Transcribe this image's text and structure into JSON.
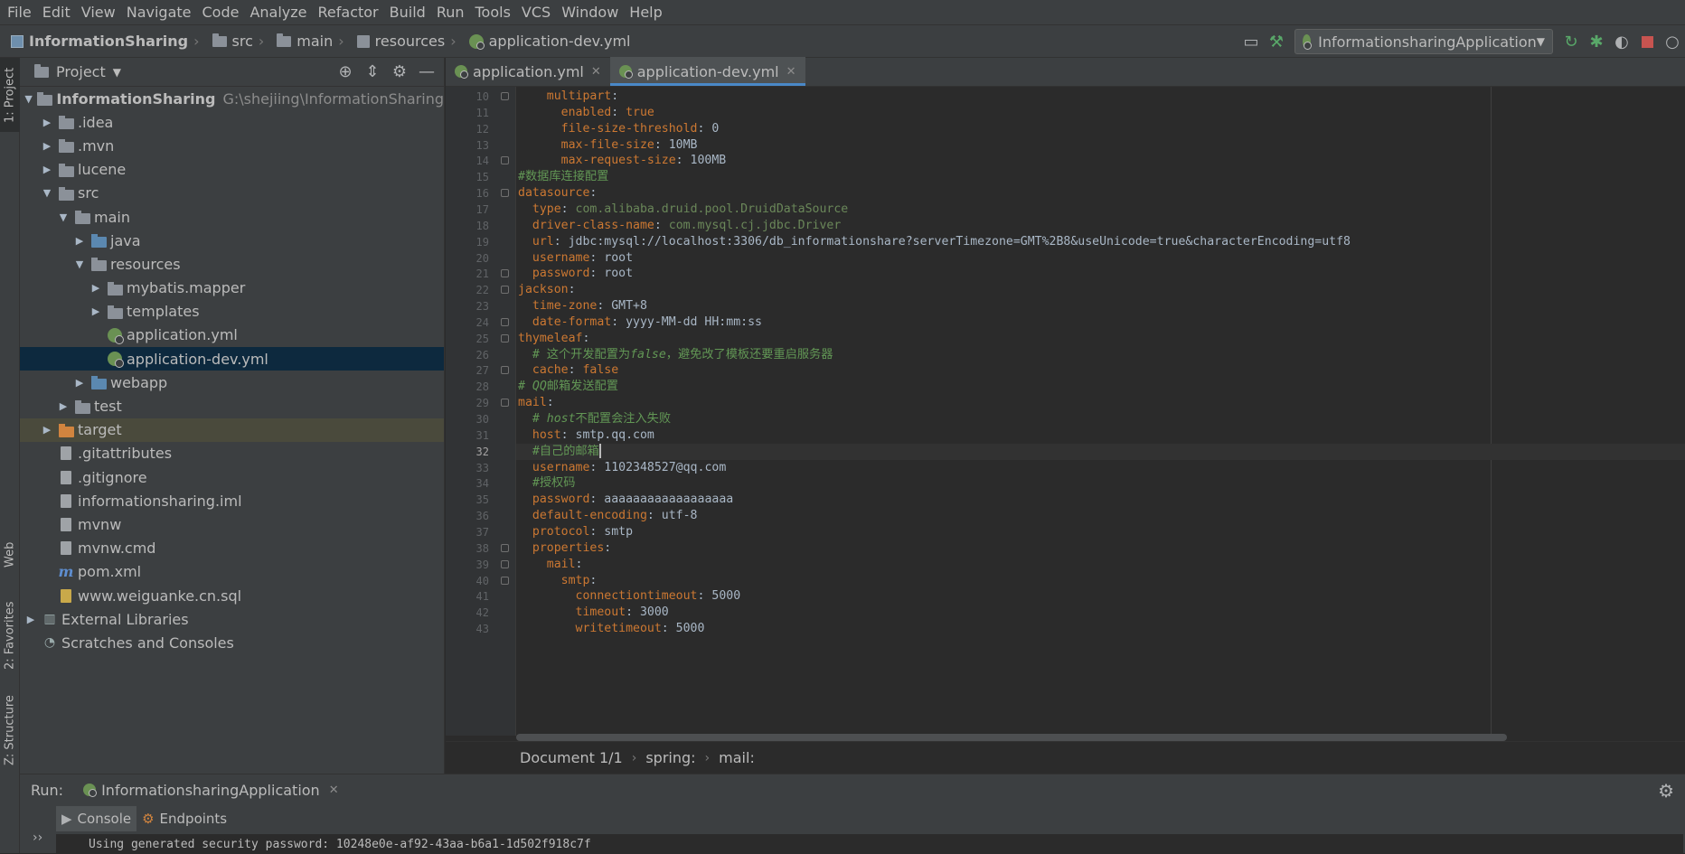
{
  "menu": [
    "File",
    "Edit",
    "View",
    "Navigate",
    "Code",
    "Analyze",
    "Refactor",
    "Build",
    "Run",
    "Tools",
    "VCS",
    "Window",
    "Help"
  ],
  "nav": {
    "project": "InformationSharing",
    "crumbs": [
      "src",
      "main",
      "resources",
      "application-dev.yml"
    ],
    "run_config": "InformationsharingApplication"
  },
  "left_strip": {
    "project": "1: Project",
    "web": "Web",
    "favorites": "2: Favorites",
    "structure": "Z: Structure"
  },
  "project_panel": {
    "title": "Project",
    "root": "InformationSharing",
    "root_path": "G:\\shejiing\\InformationSharing",
    "items": [
      ".idea",
      ".mvn",
      "lucene",
      "src",
      "main",
      "java",
      "resources",
      "mybatis.mapper",
      "templates",
      "application.yml",
      "application-dev.yml",
      "webapp",
      "test",
      "target",
      ".gitattributes",
      ".gitignore",
      "informationsharing.iml",
      "mvnw",
      "mvnw.cmd",
      "pom.xml",
      "www.weiguanke.cn.sql",
      "External Libraries",
      "Scratches and Consoles"
    ]
  },
  "editor": {
    "tabs": [
      "application.yml",
      "application-dev.yml"
    ],
    "lines": [
      {
        "n": "10",
        "t": [
          [
            "k",
            "    multipart"
          ],
          [
            "vv",
            ":"
          ]
        ]
      },
      {
        "n": "11",
        "t": [
          [
            "k",
            "      enabled"
          ],
          [
            "vv",
            ": "
          ],
          [
            "k",
            "true"
          ]
        ]
      },
      {
        "n": "12",
        "t": [
          [
            "k",
            "      file-size-threshold"
          ],
          [
            "vv",
            ": 0"
          ]
        ]
      },
      {
        "n": "13",
        "t": [
          [
            "k",
            "      max-file-size"
          ],
          [
            "vv",
            ": 10MB"
          ]
        ]
      },
      {
        "n": "14",
        "t": [
          [
            "k",
            "      max-request-size"
          ],
          [
            "vv",
            ": 100MB"
          ]
        ]
      },
      {
        "n": "15",
        "t": [
          [
            "c",
            "#数据库连接配置"
          ]
        ]
      },
      {
        "n": "16",
        "t": [
          [
            "k",
            "datasource"
          ],
          [
            "vv",
            ":"
          ]
        ]
      },
      {
        "n": "17",
        "t": [
          [
            "k",
            "  type"
          ],
          [
            "vv",
            ": "
          ],
          [
            "v",
            "com.alibaba.druid.pool.DruidDataSource"
          ]
        ]
      },
      {
        "n": "18",
        "t": [
          [
            "k",
            "  driver-class-name"
          ],
          [
            "vv",
            ": "
          ],
          [
            "v",
            "com.mysql.cj.jdbc.Driver"
          ]
        ]
      },
      {
        "n": "19",
        "t": [
          [
            "k",
            "  url"
          ],
          [
            "vv",
            ": jdbc:mysql://localhost:3306/db_informationshare?serverTimezone=GMT%2B8&useUnicode=true&characterEncoding=utf8"
          ]
        ]
      },
      {
        "n": "20",
        "t": [
          [
            "k",
            "  username"
          ],
          [
            "vv",
            ": root"
          ]
        ]
      },
      {
        "n": "21",
        "t": [
          [
            "k",
            "  password"
          ],
          [
            "vv",
            ": root"
          ]
        ]
      },
      {
        "n": "22",
        "t": [
          [
            "k",
            "jackson"
          ],
          [
            "vv",
            ":"
          ]
        ]
      },
      {
        "n": "23",
        "t": [
          [
            "k",
            "  time-zone"
          ],
          [
            "vv",
            ": GMT+8"
          ]
        ]
      },
      {
        "n": "24",
        "t": [
          [
            "k",
            "  date-format"
          ],
          [
            "vv",
            ": yyyy-MM-dd HH:mm:ss"
          ]
        ]
      },
      {
        "n": "25",
        "t": [
          [
            "k",
            "thymeleaf"
          ],
          [
            "vv",
            ":"
          ]
        ]
      },
      {
        "n": "26",
        "t": [
          [
            "c",
            "  # 这个开发配置为"
          ],
          [
            "ci",
            "false"
          ],
          [
            "c",
            "，避免改了模板还要重启服务器"
          ]
        ]
      },
      {
        "n": "27",
        "t": [
          [
            "k",
            "  cache"
          ],
          [
            "vv",
            ": "
          ],
          [
            "k",
            "false"
          ]
        ]
      },
      {
        "n": "28",
        "t": [
          [
            "c",
            "# "
          ],
          [
            "ci",
            "QQ"
          ],
          [
            "c",
            "邮箱发送配置"
          ]
        ]
      },
      {
        "n": "29",
        "t": [
          [
            "k",
            "mail"
          ],
          [
            "vv",
            ":"
          ]
        ]
      },
      {
        "n": "30",
        "t": [
          [
            "c",
            "  # "
          ],
          [
            "ci",
            "host"
          ],
          [
            "c",
            "不配置会注入失败"
          ]
        ]
      },
      {
        "n": "31",
        "t": [
          [
            "k",
            "  host"
          ],
          [
            "vv",
            ": smtp.qq.com"
          ]
        ]
      },
      {
        "n": "32",
        "t": [
          [
            "c",
            "  #自己的邮箱"
          ]
        ]
      },
      {
        "n": "33",
        "t": [
          [
            "k",
            "  username"
          ],
          [
            "vv",
            ": 1102348527@qq.com"
          ]
        ]
      },
      {
        "n": "34",
        "t": [
          [
            "c",
            "  #授权码"
          ]
        ]
      },
      {
        "n": "35",
        "t": [
          [
            "k",
            "  password"
          ],
          [
            "vv",
            ": aaaaaaaaaaaaaaaaaa"
          ]
        ]
      },
      {
        "n": "36",
        "t": [
          [
            "k",
            "  default-encoding"
          ],
          [
            "vv",
            ": utf-8"
          ]
        ]
      },
      {
        "n": "37",
        "t": [
          [
            "k",
            "  protocol"
          ],
          [
            "vv",
            ": smtp"
          ]
        ]
      },
      {
        "n": "38",
        "t": [
          [
            "k",
            "  properties"
          ],
          [
            "vv",
            ":"
          ]
        ]
      },
      {
        "n": "39",
        "t": [
          [
            "k",
            "    mail"
          ],
          [
            "vv",
            ":"
          ]
        ]
      },
      {
        "n": "40",
        "t": [
          [
            "k",
            "      smtp"
          ],
          [
            "vv",
            ":"
          ]
        ]
      },
      {
        "n": "41",
        "t": [
          [
            "k",
            "        connectiontimeout"
          ],
          [
            "vv",
            ": 5000"
          ]
        ]
      },
      {
        "n": "42",
        "t": [
          [
            "k",
            "        timeout"
          ],
          [
            "vv",
            ": 3000"
          ]
        ]
      },
      {
        "n": "43",
        "t": [
          [
            "k",
            "        writetimeout"
          ],
          [
            "vv",
            ": 5000"
          ]
        ]
      }
    ],
    "breadcrumb": [
      "Document 1/1",
      "spring:",
      "mail:"
    ]
  },
  "run_panel": {
    "label": "Run:",
    "config": "InformationsharingApplication",
    "tabs": [
      "Console",
      "Endpoints"
    ],
    "output": "Using generated security password: 10248e0e-af92-43aa-b6a1-1d502f918c7f"
  },
  "colors": {
    "bg": "#2b2b2b",
    "panel": "#3c3f41",
    "selection": "#0d293e",
    "keyword": "#cc7832",
    "string": "#6a8759",
    "comment": "#629755"
  }
}
